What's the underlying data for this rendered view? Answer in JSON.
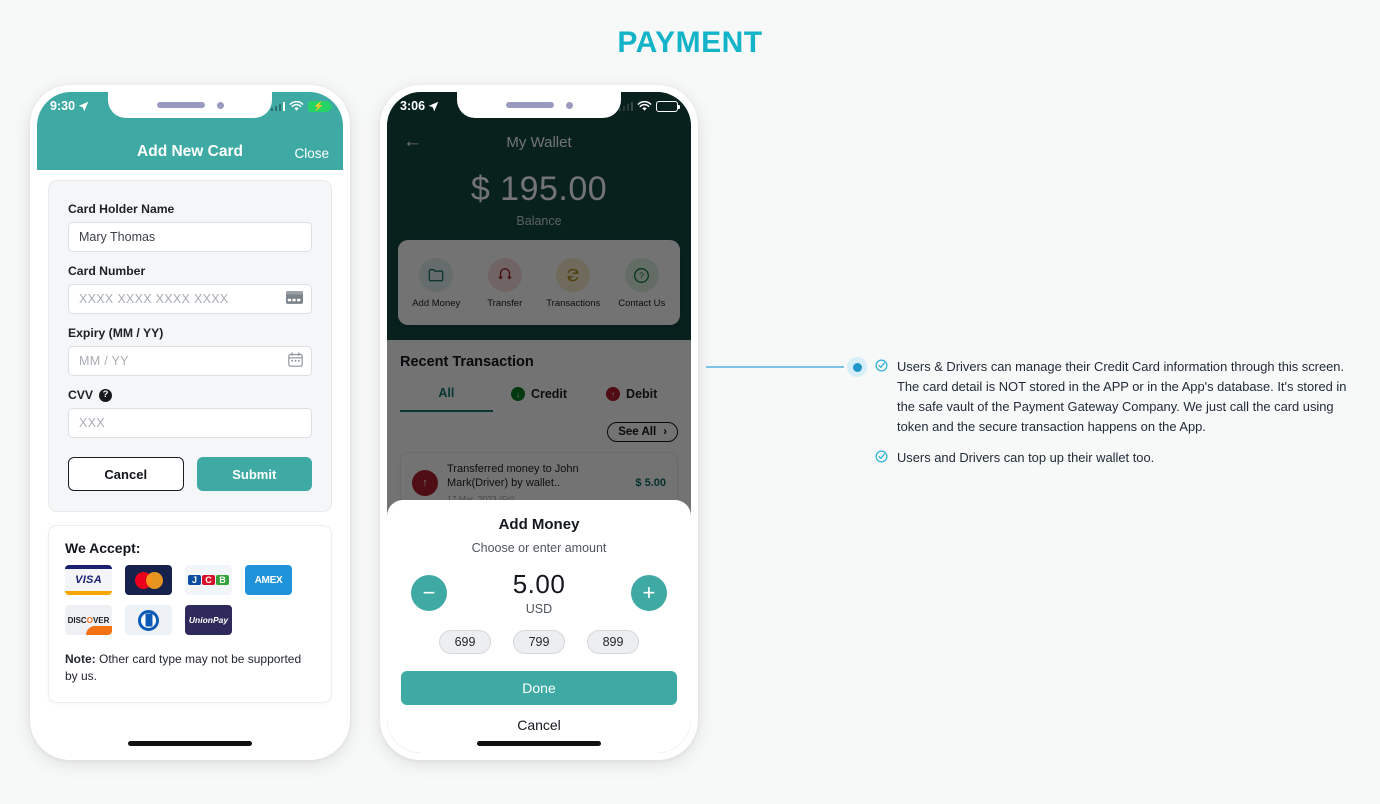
{
  "title": "PAYMENT",
  "accent": {
    "teal": "#3faaa4",
    "dark_teal": "#124a42",
    "cyan": "#13b3c8",
    "line_blue": "#7cc4e3"
  },
  "phone1": {
    "status": {
      "time": "9:30",
      "location_icon": "location-arrow-icon",
      "signal_icon": "signal-bars-icon",
      "wifi_icon": "wifi-icon",
      "battery_icon": "battery-charging-icon"
    },
    "header": {
      "title": "Add New Card",
      "close_label": "Close"
    },
    "form": {
      "fields": [
        {
          "label": "Card Holder Name",
          "value": "Mary Thomas",
          "placeholder": "",
          "is_placeholder": false,
          "icon": ""
        },
        {
          "label": "Card Number",
          "value": "XXXX XXXX XXXX XXXX",
          "placeholder": "XXXX XXXX XXXX XXXX",
          "is_placeholder": true,
          "icon": "credit-card-icon"
        },
        {
          "label": "Expiry (MM / YY)",
          "value": "MM / YY",
          "placeholder": "MM / YY",
          "is_placeholder": true,
          "icon": "calendar-icon"
        },
        {
          "label": "CVV",
          "value": "XXX",
          "placeholder": "XXX",
          "is_placeholder": true,
          "icon": "",
          "help": "?"
        }
      ],
      "cancel_label": "Cancel",
      "submit_label": "Submit"
    },
    "accept": {
      "title": "We Accept:",
      "cards": [
        "VISA",
        "Mastercard",
        "JCB",
        "AMEX",
        "DISCOVER",
        "Diners Club",
        "UnionPay"
      ],
      "visa_text": "VISA",
      "jcb_letters": [
        "J",
        "C",
        "B"
      ],
      "amex_text": "AMEX",
      "discover_pre": "DISC",
      "discover_o": "O",
      "discover_post": "VER",
      "unionpay_text": "UnionPay",
      "note_bold": "Note:",
      "note_text": " Other card type may not be supported by us."
    }
  },
  "phone2": {
    "status": {
      "time": "3:06",
      "location_icon": "location-arrow-icon",
      "signal_icon": "signal-bars-icon",
      "wifi_icon": "wifi-icon",
      "battery_icon": "battery-icon"
    },
    "wallet": {
      "back_icon": "back-arrow-icon",
      "title": "My Wallet",
      "balance": "$ 195.00",
      "balance_label": "Balance",
      "actions": [
        {
          "label": "Add Money",
          "icon": "folder-plus-icon",
          "glyph": "⬚",
          "class": "ai-add"
        },
        {
          "label": "Transfer",
          "icon": "transfer-icon",
          "glyph": "⇋",
          "class": "ai-tra"
        },
        {
          "label": "Transactions",
          "icon": "refresh-money-icon",
          "glyph": "↻",
          "class": "ai-trn"
        },
        {
          "label": "Contact Us",
          "icon": "question-circle-icon",
          "glyph": "?",
          "class": "ai-con"
        }
      ]
    },
    "recent": {
      "title": "Recent Transaction",
      "tabs": [
        {
          "label": "All",
          "active": true,
          "dot": ""
        },
        {
          "label": "Credit",
          "active": false,
          "dot": "credit"
        },
        {
          "label": "Debit",
          "active": false,
          "dot": "debit"
        }
      ],
      "see_all_label": "See All",
      "see_all_icon": "chevron-right-icon",
      "transactions": [
        {
          "icon": "arrow-up-icon",
          "title": "Transferred money to John Mark(Driver) by wallet..",
          "date": "17 Mar, 2023 (Fri)",
          "amount": "$ 5.00"
        }
      ]
    },
    "sheet": {
      "title": "Add Money",
      "subtitle": "Choose or enter amount",
      "minus_icon": "minus-circle-icon",
      "plus_icon": "plus-circle-icon",
      "amount": "5.00",
      "currency": "USD",
      "chips": [
        "699",
        "799",
        "899"
      ],
      "done_label": "Done",
      "cancel_label": "Cancel"
    }
  },
  "annotations": {
    "bullet_icon": "check-circle-icon",
    "items": [
      "Users & Drivers can manage their Credit Card information through this screen. The card detail is NOT stored in the APP or in the App's database. It's stored in the safe vault of the Payment Gateway Company. We just call the card using token and the secure transaction happens on the App.",
      "Users and Drivers can top up their wallet too."
    ]
  }
}
